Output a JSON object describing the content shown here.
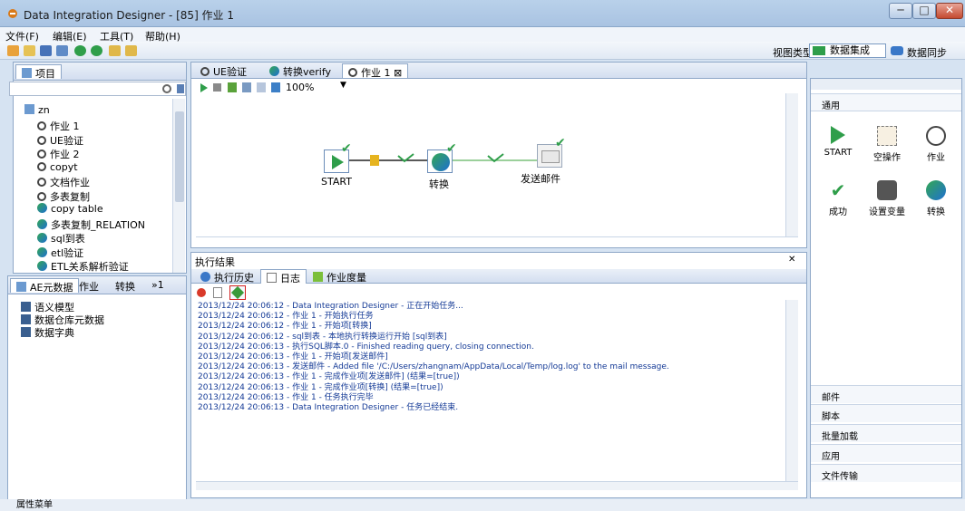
{
  "window": {
    "title": "Data Integration Designer - [85] 作业 1",
    "min": "─",
    "max": "□",
    "close": "✕"
  },
  "menu": [
    "文件(F)",
    "编辑(E)",
    "工具(T)",
    "帮助(H)"
  ],
  "view": {
    "label": "视图类型:",
    "integration": "数据集成",
    "sync": "数据同步"
  },
  "left_top": {
    "tab": "项目",
    "root": "zn",
    "items": [
      {
        "label": "作业 1",
        "type": "job"
      },
      {
        "label": "UE验证",
        "type": "job"
      },
      {
        "label": "作业 2",
        "type": "job"
      },
      {
        "label": "copyt",
        "type": "job"
      },
      {
        "label": "文档作业",
        "type": "job"
      },
      {
        "label": "多表复制",
        "type": "job"
      },
      {
        "label": "copy table",
        "type": "trans"
      },
      {
        "label": "多表复制_RELATION",
        "type": "trans"
      },
      {
        "label": "sql到表",
        "type": "trans"
      },
      {
        "label": "etl验证",
        "type": "trans"
      },
      {
        "label": "ETL关系解析验证",
        "type": "trans"
      }
    ]
  },
  "left_bottom": {
    "tabs": [
      "AE元数据",
      "作业",
      "转换",
      "»1"
    ],
    "items": [
      "语义模型",
      "数据仓库元数据",
      "数据字典"
    ]
  },
  "editor": {
    "tabs": [
      "UE验证",
      "转换verify",
      "作业 1 ⊠"
    ],
    "zoom": "100%"
  },
  "canvas": {
    "nodes": [
      "START",
      "转换",
      "发送邮件"
    ]
  },
  "palette": {
    "header": "通用",
    "items": [
      "START",
      "空操作",
      "作业",
      "成功",
      "设置变量",
      "转换"
    ],
    "categories": [
      "邮件",
      "脚本",
      "批量加载",
      "应用",
      "文件传输"
    ]
  },
  "results": {
    "title": "执行结果",
    "close": "✕",
    "tabs": [
      "执行历史",
      "日志",
      "作业度量"
    ],
    "log": [
      "2013/12/24 20:06:12 - Data Integration Designer - 正在开始任务...",
      "2013/12/24 20:06:12 - 作业 1 - 开始执行任务",
      "2013/12/24 20:06:12 - 作业 1 - 开始项[转换]",
      "2013/12/24 20:06:12 - sql到表 - 本地执行转换运行开始 [sql到表]",
      "2013/12/24 20:06:13 - 执行SQL脚本.0 - Finished reading query, closing connection.",
      "2013/12/24 20:06:13 - 作业 1 - 开始项[发送邮件]",
      "2013/12/24 20:06:13 - 发送邮件 - Added file '/C:/Users/zhangnam/AppData/Local/Temp/log.log' to the mail message.",
      "2013/12/24 20:06:13 - 作业 1 - 完成作业项[发送邮件] (结果=[true])",
      "2013/12/24 20:06:13 - 作业 1 - 完成作业项[转换] (结果=[true])",
      "2013/12/24 20:06:13 - 作业 1 - 任务执行完毕",
      "2013/12/24 20:06:13 - Data Integration Designer - 任务已经结束."
    ]
  },
  "status": "属性菜单"
}
